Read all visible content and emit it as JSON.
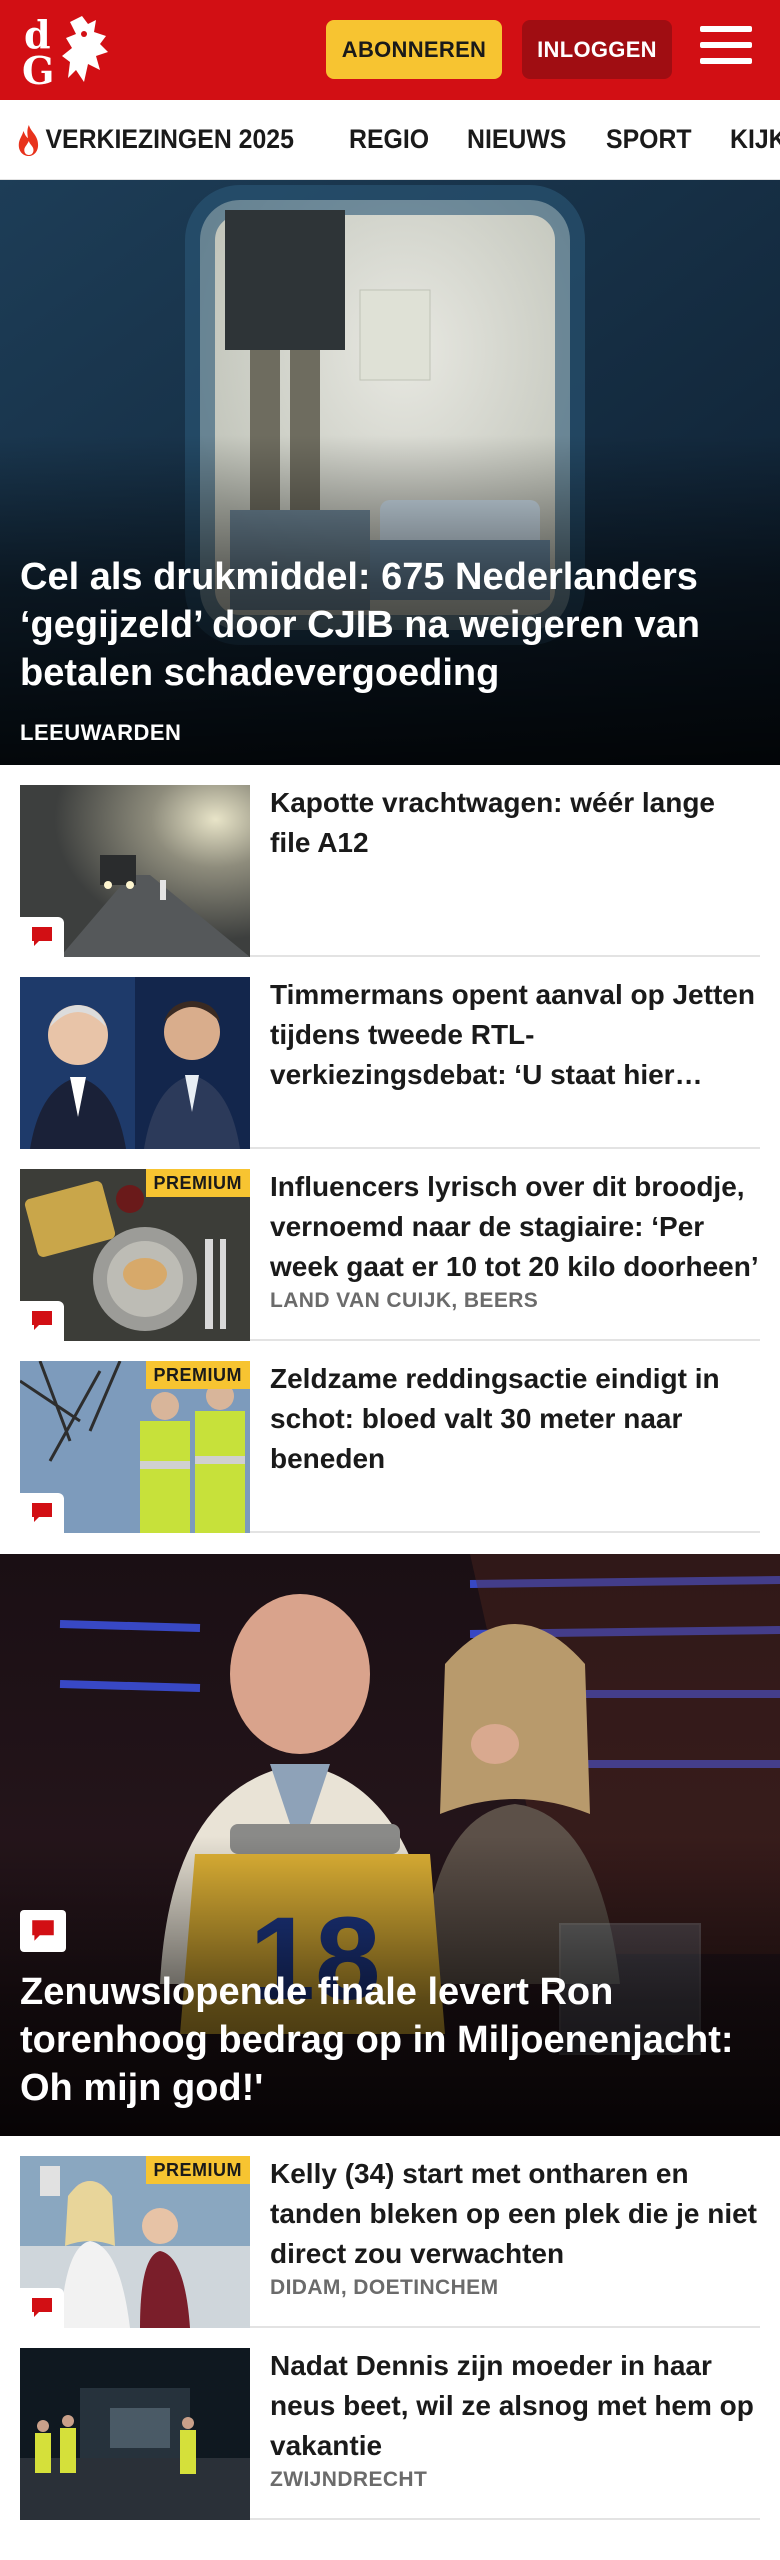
{
  "header": {
    "logo_letters": "dG",
    "subscribe_label": "ABONNEREN",
    "login_label": "INLOGGEN",
    "menu_icon": "hamburger-icon",
    "brand_color": "#d20f14",
    "accent_color": "#f7c431"
  },
  "nav": {
    "items": [
      {
        "label": "VERKIEZINGEN 2025",
        "icon": "flame-icon"
      },
      {
        "label": "REGIO"
      },
      {
        "label": "NIEUWS"
      },
      {
        "label": "SPORT"
      },
      {
        "label": "KIJK"
      }
    ]
  },
  "hero": {
    "title": "Cel als drukmiddel: 675 Nederlanders ‘gegijzeld’ door CJIB na weigeren van betalen schadevergoeding",
    "location": "LEEUWARDEN"
  },
  "articles": [
    {
      "title": "Kapotte vrachtwagen: wéér lange file A12",
      "location": "",
      "premium": false,
      "comment_icon": true
    },
    {
      "title": "Timmermans opent aanval op Jetten tijdens tweede RTL-verkiezingsdebat: ‘U staat hier helemaal niet om te winnen’",
      "location": "",
      "premium": false,
      "comment_icon": false
    },
    {
      "title": "Influencers lyrisch over dit broodje, vernoemd naar de stagiaire: ‘Per week gaat er 10 tot 20 kilo doorheen’",
      "location": "LAND VAN CUIJK, BEERS",
      "premium": true,
      "comment_icon": true
    },
    {
      "title": "Zeldzame reddingsactie eindigt in schot: bloed valt 30 meter naar beneden",
      "location": "",
      "premium": true,
      "comment_icon": true
    }
  ],
  "feature": {
    "title": "Zenuwslopende finale levert Ron torenhoog bedrag op in Miljoenen­jacht: Oh mijn god!'",
    "podium_number": "18"
  },
  "articles2": [
    {
      "title": "Kelly (34) start met ontharen en tanden bleken op een plek die je niet direct zou verwachten",
      "location": "DIDAM, DOETINCHEM",
      "premium": true,
      "comment_icon": true
    },
    {
      "title": "Nadat Dennis zijn moeder in haar neus beet, wil ze alsnog met hem op vakantie",
      "location": "ZWIJNDRECHT",
      "premium": false,
      "comment_icon": false
    }
  ],
  "labels": {
    "premium": "PREMIUM"
  }
}
